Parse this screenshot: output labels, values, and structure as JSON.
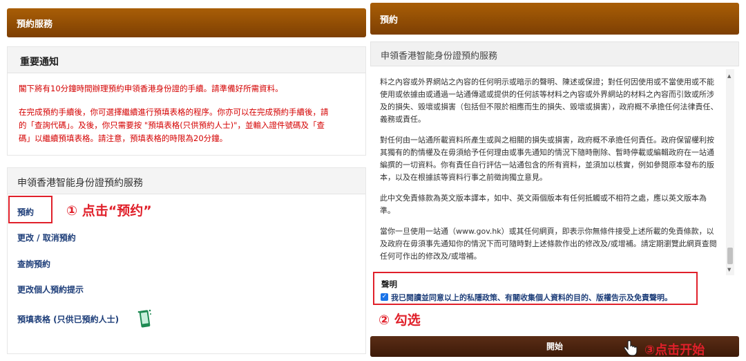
{
  "left": {
    "header": "預約服務",
    "notice": {
      "title": "重要通知",
      "p1": "閣下將有10分鐘時間辦理預約申領香港身份證的手續。請準備好所需資料。",
      "p2_l1": "在完成預約手續後，你可選擇繼續進行預填表格的程序。你亦可以在完成預約手續後，請",
      "p2_l2": "的「查詢代碼」。及後，你只需要按 \"預填表格(只供預約人士)\"，並輸入證件號碼及「查",
      "p2_l3": "碼」以繼續預填表格。請注意，預填表格的時限為20分鐘。"
    },
    "service": {
      "title": "申領香港智能身份證預約服務",
      "links": [
        "預約",
        "更改 / 取消預約",
        "查詢預約",
        "更改個人預約提示",
        "預填表格 (只供已預約人士)"
      ]
    },
    "annotation": "① 点击“预约”"
  },
  "right": {
    "header": "預約",
    "subtitle": "申領香港智能身份證預約服務",
    "paragraphs": [
      "料之內容或外界網站之內容的任何明示或暗示的聲明、陳述或保證；對任何因使用或不當使用或不能使用或依據由或通過一站通傳遞或提供的任何該等材料之內容或外界網站的材料之內容而引致或所涉及的損失、毀壞或損害（包括但不限於相應而生的損失、毀壞或損害），政府概不承擔任何法律責任、義務或責任。",
      "對任何由一站通所載資料所產生或與之相關的損失或損害，政府概不承擔任何責任。政府保留權利按其獨有的酌情權及在毋須給予任何理由或事先通知的情況下隨時刪除、暫時停載或編輯政府在一站通編撰的一切資料。你有責任自行評估一站通包含的所有資料，並須加以核實，例如參閱原本發布的版本，以及在根據該等資料行事之前徵詢獨立意見。",
      "此中文免責條款為英文版本譯本，如中、英文兩個版本有任何抵觸或不相符之處，應以英文版本為準。",
      "當你一旦使用一站通（www.gov.hk）或其任何網頁，即表示你無條件接受上述所載的免責條款，以及政府在毋須事先通知你的情況下而可隨時對上述條款作出的修改及/或增補。請定期瀏覽此網頁查閱任何可作出的修改及/或增補。"
    ],
    "declaration_title": "聲明",
    "declaration_label": "我已閱讀並同意以上的私隱政策、有關收集個人資料的目的、版權告示及免責聲明。",
    "annotation2": "② 勾选",
    "start_button": "開始",
    "annotation3": "③点击开始"
  }
}
